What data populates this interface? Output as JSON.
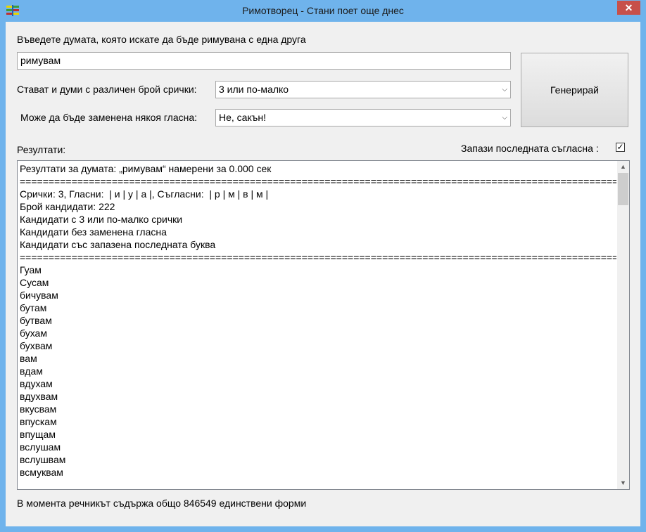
{
  "window": {
    "title": "Римотворец - Стани поет още днес",
    "close_label": "✕"
  },
  "form": {
    "word_prompt": "Въведете думата, която искате да бъде римувана с една друга",
    "word_value": "римувам",
    "syllables_label": "Стават и думи с различен брой срички:",
    "syllables_value": "3 или по-малко",
    "vowel_label": "Може да бъде заменена някоя гласна:",
    "vowel_value": "Не, сакън!",
    "generate_label": "Генерирай",
    "results_label": "Резултати:",
    "keep_consonant_label": "Запази последната съгласна :",
    "keep_consonant_checked": true
  },
  "results": {
    "lines": [
      "Резултати за думата: „римувам“ намерени за 0.000 сек",
      "==========================================================================================================",
      "Срички: 3, Гласни:  | и | у | а |, Съгласни:  | р | м | в | м |",
      "Брой кандидати: 222",
      "Кандидати с 3 или по-малко срички",
      "Кандидати без заменена гласна",
      "Кандидати със запазена последната буква",
      "==========================================================================================================",
      "Гуам",
      "Сусам",
      "бичувам",
      "бутам",
      "бутвам",
      "бухам",
      "бухвам",
      "вам",
      "вдам",
      "вдухам",
      "вдухвам",
      "вкусвам",
      "впускам",
      "впущам",
      "вслушам",
      "вслушвам",
      "всмуквам"
    ]
  },
  "status": {
    "text": "В момента речникът съдържа общо 846549 единствени форми"
  },
  "icons": {
    "app": "app-icon",
    "close": "close-icon",
    "dropdown": "chevron-down-icon",
    "check": "checkmark-icon"
  }
}
